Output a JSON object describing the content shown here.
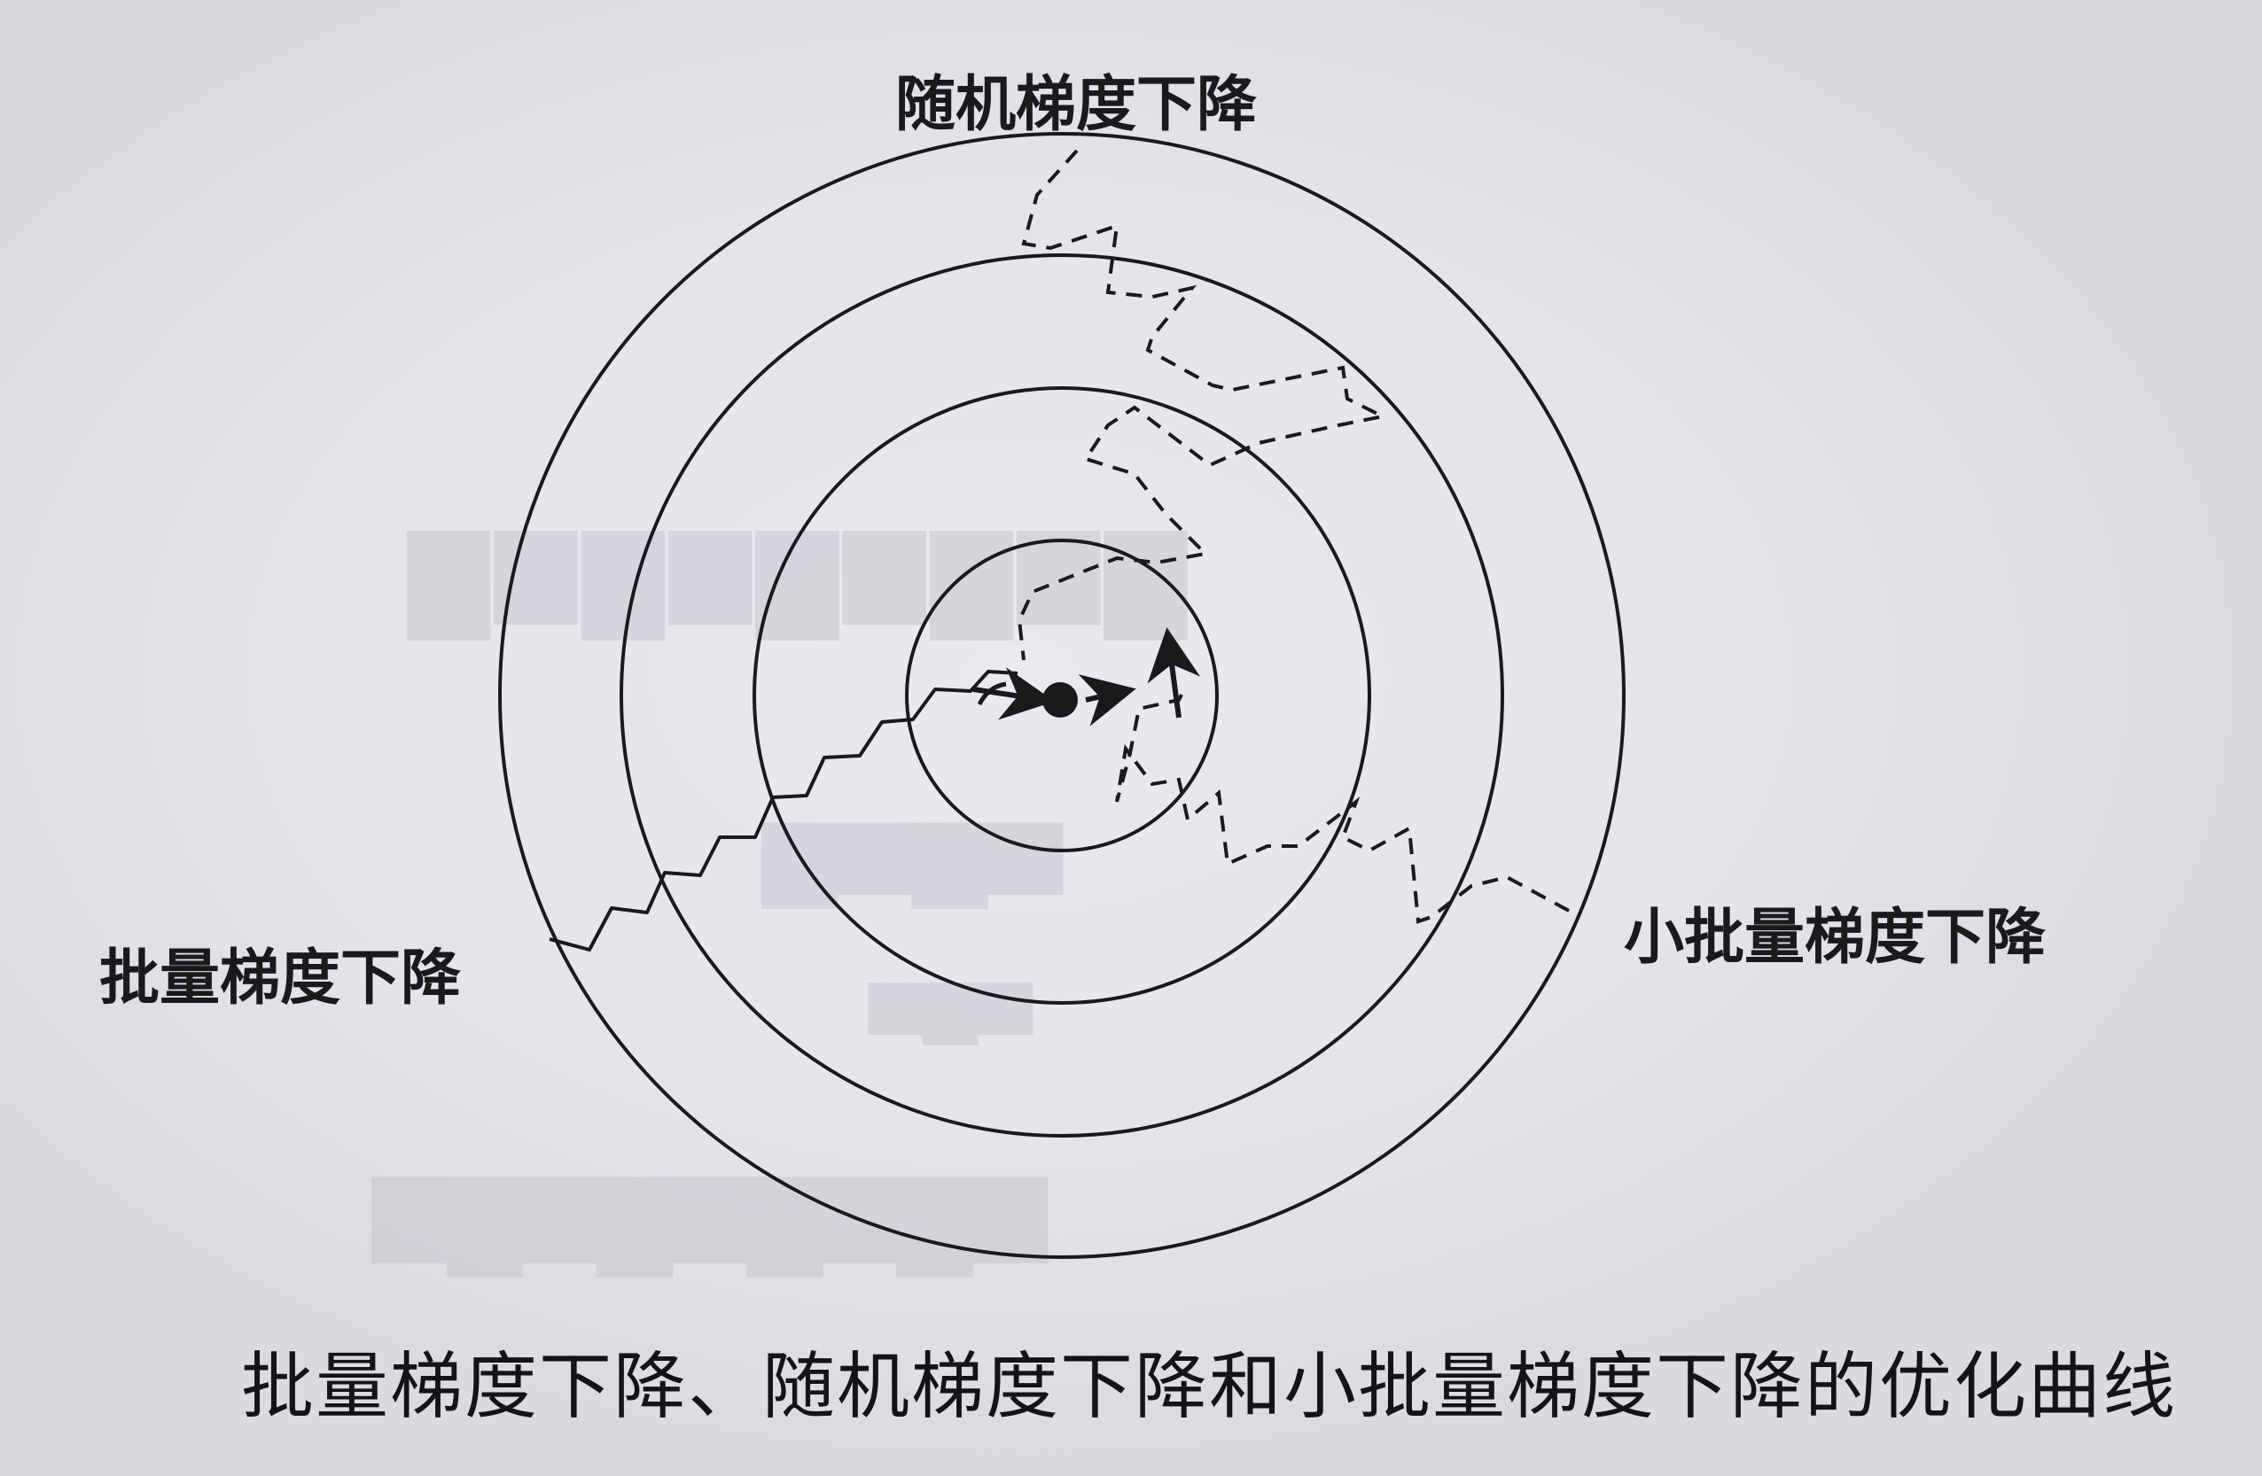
{
  "labels": {
    "sgd": "随机梯度下降",
    "bgd": "批量梯度下降",
    "mbgd": "小批量梯度下降"
  },
  "caption": "批量梯度下降、随机梯度下降和小批量梯度下降的优化曲线",
  "colors": {
    "ink": "#1a1a1c",
    "paper": "#e8e6ec"
  }
}
